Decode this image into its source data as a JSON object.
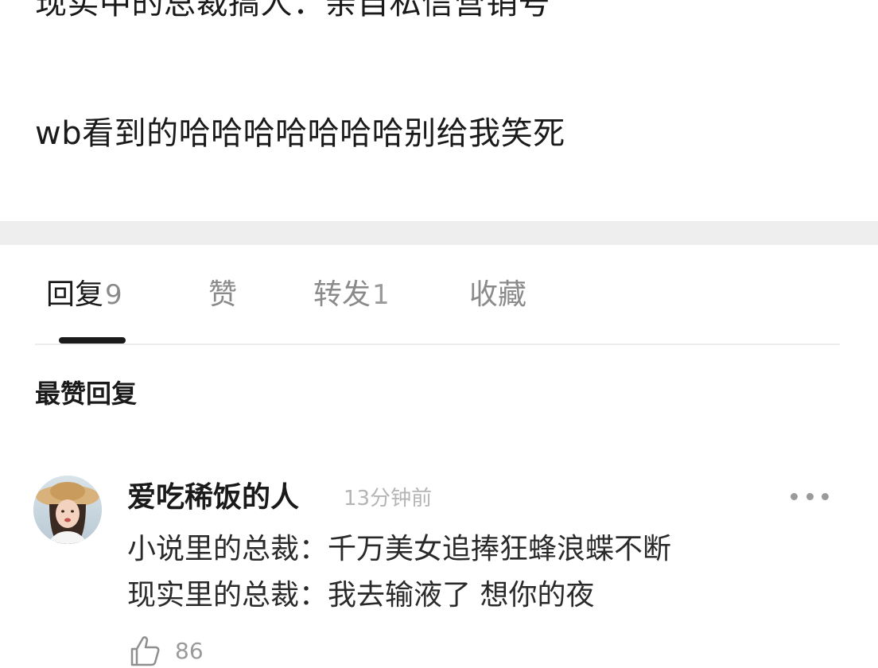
{
  "post": {
    "line1": "现实中的总裁搞人：亲自私信营销号",
    "line2": "wb看到的哈哈哈哈哈哈哈别给我笑死"
  },
  "tabs": [
    {
      "label": "回复",
      "count": "9",
      "active": true
    },
    {
      "label": "赞",
      "count": "",
      "active": false
    },
    {
      "label": "转发",
      "count": "1",
      "active": false
    },
    {
      "label": "收藏",
      "count": "",
      "active": false
    }
  ],
  "section_title": "最赞回复",
  "comment": {
    "username": "爱吃稀饭的人",
    "time": "13分钟前",
    "lines": [
      "小说里的总裁：千万美女追捧狂蜂浪蝶不断",
      "现实里的总裁：我去输液了 想你的夜"
    ],
    "like_count": "86",
    "icons": {
      "like": "thumbs-up-icon",
      "more": "more-dots-icon",
      "avatar": "user-avatar"
    }
  },
  "colors": {
    "text_primary": "#1a1a1a",
    "text_secondary": "#8a8a8a",
    "timestamp": "#b5b5b5",
    "separator": "#eeeeee",
    "tab_indicator": "#1a1a1a"
  }
}
